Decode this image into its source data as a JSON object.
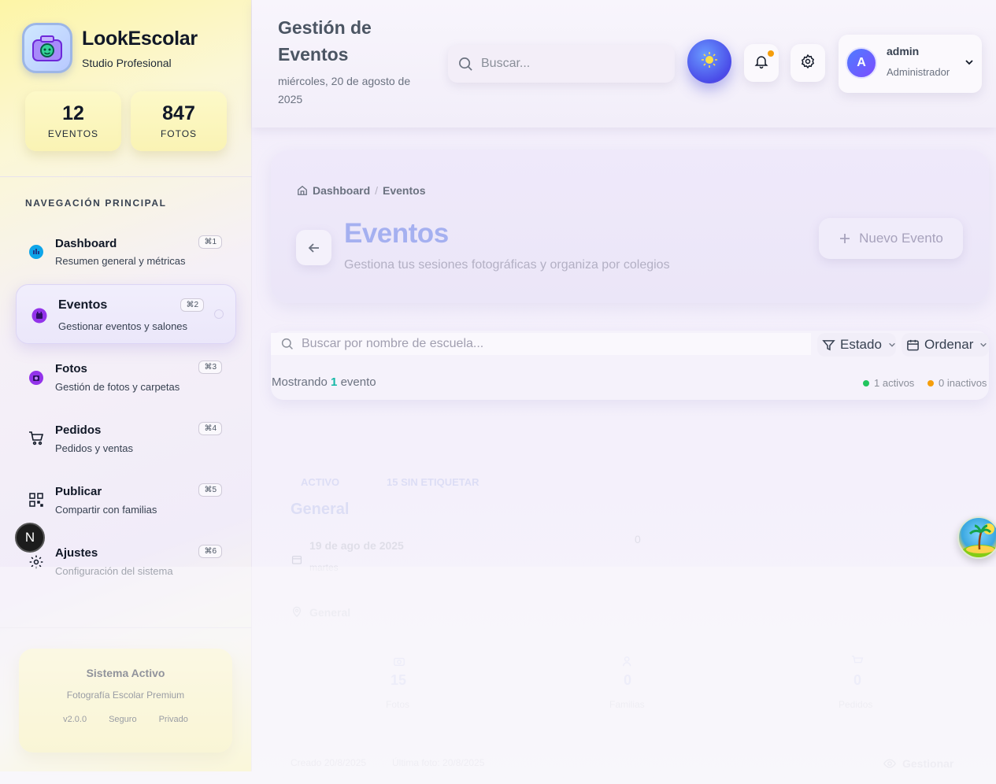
{
  "brand": {
    "name": "LookEscolar",
    "subtitle": "Studio Profesional"
  },
  "stats": [
    {
      "value": "12",
      "label": "EVENTOS"
    },
    {
      "value": "847",
      "label": "FOTOS"
    }
  ],
  "nav": {
    "title": "NAVEGACIÓN PRINCIPAL",
    "items": [
      {
        "label": "Dashboard",
        "desc": "Resumen general y métricas",
        "kbd": "⌘1",
        "icon": "dashboard-icon"
      },
      {
        "label": "Eventos",
        "desc": "Gestionar eventos y salones",
        "kbd": "⌘2",
        "icon": "calendar-icon"
      },
      {
        "label": "Fotos",
        "desc": "Gestión de fotos y carpetas",
        "kbd": "⌘3",
        "icon": "camera-icon"
      },
      {
        "label": "Pedidos",
        "desc": "Pedidos y ventas",
        "kbd": "⌘4",
        "icon": "cart-icon"
      },
      {
        "label": "Publicar",
        "desc": "Compartir con familias",
        "kbd": "⌘5",
        "icon": "qr-icon"
      },
      {
        "label": "Ajustes",
        "desc": "Configuración del sistema",
        "kbd": "⌘6",
        "icon": "gear-icon"
      }
    ]
  },
  "next_badge": "N",
  "system": {
    "title": "Sistema Activo",
    "subtitle": "Fotografía Escolar Premium",
    "tags": [
      "v2.0.0",
      "Seguro",
      "Privado"
    ]
  },
  "header": {
    "title": "Gestión de Eventos",
    "date": "miércoles, 20 de agosto de 2025",
    "search_placeholder": "Buscar...",
    "user": {
      "initial": "A",
      "name": "admin",
      "role": "Administrador"
    }
  },
  "hero": {
    "breadcrumb": [
      "Dashboard",
      "Eventos"
    ],
    "title": "Eventos",
    "subtitle": "Gestiona tus sesiones fotográficas y organiza por colegios",
    "new_button": "Nuevo Evento"
  },
  "filters": {
    "search_placeholder": "Buscar por nombre de escuela...",
    "estado": "Estado",
    "ordenar": "Ordenar",
    "showing_prefix": "Mostrando",
    "showing_count": "1",
    "showing_suffix": "evento",
    "active": "1 activos",
    "inactive": "0 inactivos"
  },
  "event": {
    "badge_active": "ACTIVO",
    "badge_untagged": "15 SIN ETIQUETAR",
    "name": "General",
    "date": "19 de ago de 2025",
    "weekday": "martes",
    "count_right": "0",
    "location": "General",
    "stats": [
      {
        "value": "15",
        "label": "Fotos"
      },
      {
        "value": "0",
        "label": "Familias"
      },
      {
        "value": "0",
        "label": "Pedidos"
      }
    ],
    "created": "Creado 20/8/2025",
    "last_photo": "Última foto: 20/8/2025",
    "manage": "Gestionar"
  },
  "colors": {
    "accent": "#6366f1",
    "sidebar_yellow": "#fdf5a6",
    "active_dot": "#22c55e",
    "inactive_dot": "#f59e0b"
  }
}
